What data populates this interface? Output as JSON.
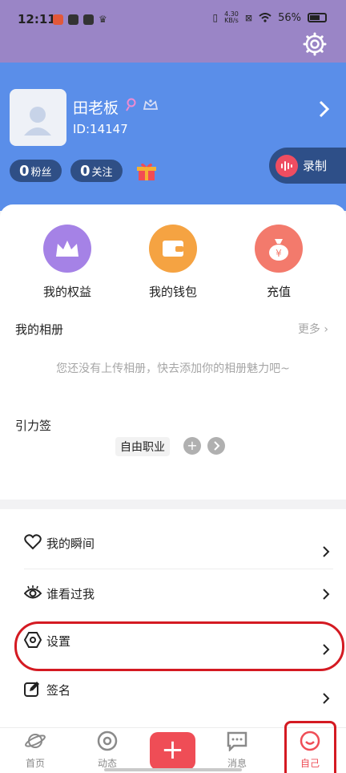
{
  "status_bar": {
    "time": "12:11",
    "net_speed_value": "4.30",
    "net_speed_unit": "KB/s",
    "battery": "56%"
  },
  "profile": {
    "name": "田老板",
    "id": "ID:14147",
    "fans_count": "0",
    "fans_label": "粉丝",
    "following_count": "0",
    "following_label": "关注",
    "record_label": "录制"
  },
  "quick_actions": [
    {
      "label": "我的权益",
      "icon": "crown-icon",
      "color": "#a582e6"
    },
    {
      "label": "我的钱包",
      "icon": "wallet-icon",
      "color": "#f5a342"
    },
    {
      "label": "充值",
      "icon": "money-bag-icon",
      "color": "#f37a6c"
    }
  ],
  "album": {
    "title": "我的相册",
    "more": "更多",
    "empty_text": "您还没有上传相册，快去添加你的相册魅力吧~"
  },
  "tags": {
    "title": "引力签",
    "items": [
      "自由职业"
    ],
    "add": "+"
  },
  "menu": [
    {
      "label": "我的瞬间",
      "icon": "heart-icon"
    },
    {
      "label": "谁看过我",
      "icon": "eye-icon"
    },
    {
      "label": "设置",
      "icon": "settings-hexagon-icon"
    },
    {
      "label": "签名",
      "icon": "edit-icon"
    }
  ],
  "bottom_nav": [
    {
      "label": "首页",
      "icon": "planet-icon"
    },
    {
      "label": "动态",
      "icon": "moments-icon"
    },
    {
      "label": "",
      "icon": "plus-icon"
    },
    {
      "label": "消息",
      "icon": "message-icon"
    },
    {
      "label": "自己",
      "icon": "me-icon",
      "active": true
    }
  ],
  "colors": {
    "header_purple": "#9a85c6",
    "profile_blue": "#5a8ee9",
    "accent_red": "#ef4d56",
    "highlight_red": "#d41a22"
  }
}
